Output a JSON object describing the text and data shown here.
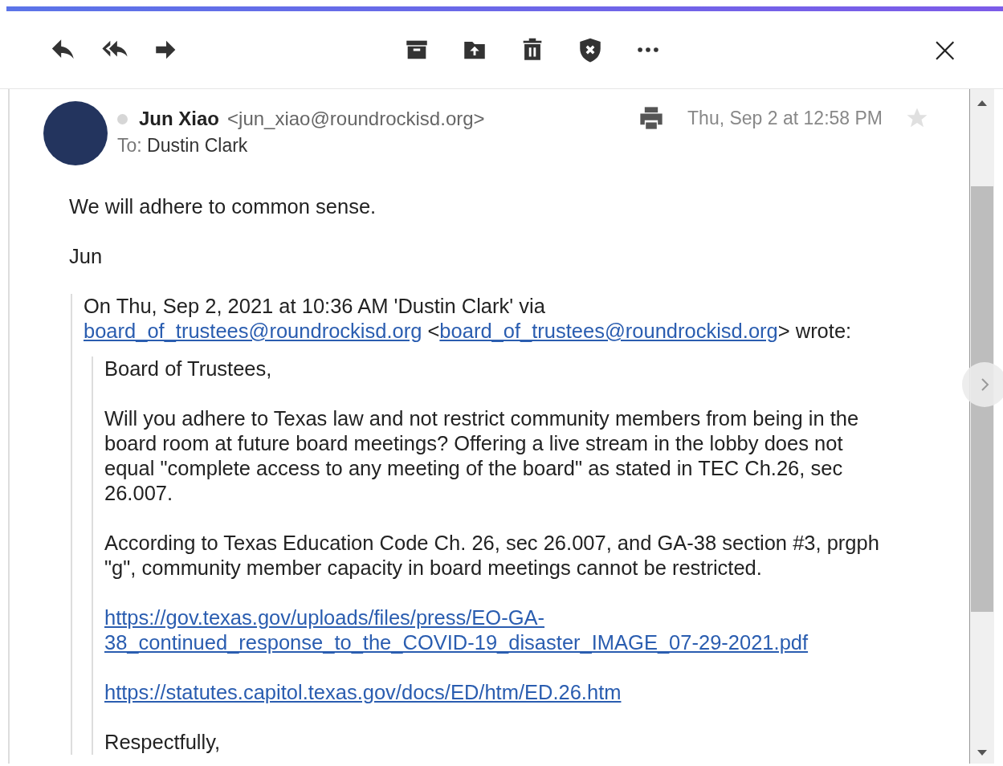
{
  "toolbar": {
    "close": "×"
  },
  "message": {
    "sender": {
      "name": "Jun Xiao",
      "email": "<jun_xiao@roundrockisd.org>",
      "online": false
    },
    "to_label": "To:",
    "to": "Dustin Clark",
    "date": "Thu, Sep 2 at 12:58 PM",
    "starred": false,
    "body": [
      "We will adhere to common sense.",
      "Jun"
    ],
    "quote": {
      "intro": [
        {
          "kind": "text",
          "text": "On Thu, Sep 2, 2021 at 10:36 AM 'Dustin Clark' via"
        },
        {
          "kind": "link",
          "text": "board_of_trustees@roundrockisd.org"
        },
        {
          "kind": "text",
          "text": " <"
        },
        {
          "kind": "link",
          "text": "board_of_trustees@roundrockisd.org"
        },
        {
          "kind": "text",
          "text": "> wrote:"
        }
      ],
      "paragraphs": [
        {
          "kind": "text",
          "text": "Board of Trustees,"
        },
        {
          "kind": "text",
          "text": "Will you adhere to Texas law and not restrict community members from being in the board room at future board meetings? Offering a live stream in the lobby does not equal \"complete access to any meeting of the board\" as stated in TEC Ch.26, sec 26.007."
        },
        {
          "kind": "text",
          "text": "According to Texas Education Code Ch. 26, sec 26.007, and GA-38 section #3, prgph \"g\", community member capacity in board meetings cannot be restricted."
        },
        {
          "kind": "link",
          "text": "https://gov.texas.gov/uploads/files/press/EO-GA-38_continued_response_to_the_COVID-19_disaster_IMAGE_07-29-2021.pdf"
        },
        {
          "kind": "link",
          "text": "https://statutes.capitol.texas.gov/docs/ED/htm/ED.26.htm"
        },
        {
          "kind": "text",
          "text": "Respectfully,"
        }
      ]
    }
  }
}
